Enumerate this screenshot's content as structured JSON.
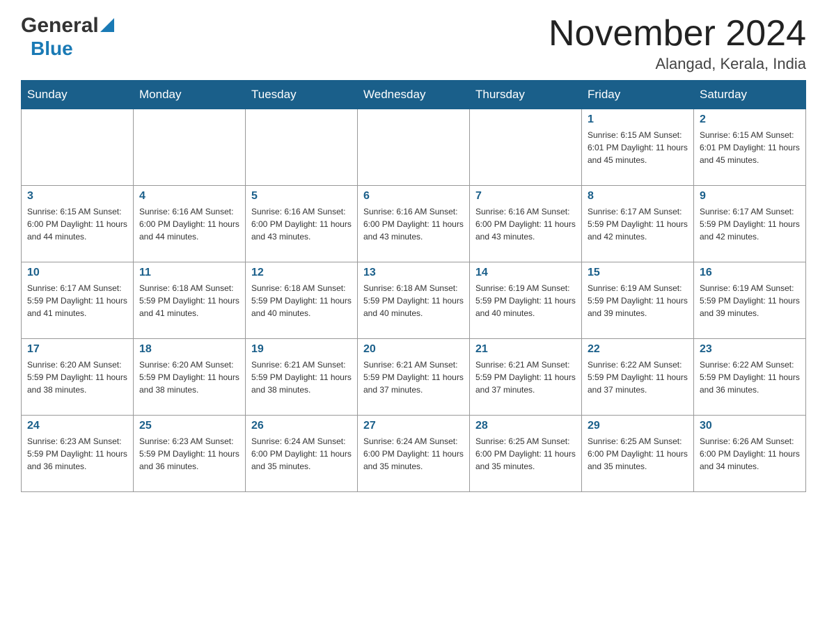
{
  "header": {
    "logo_general": "General",
    "logo_blue": "Blue",
    "month_title": "November 2024",
    "location": "Alangad, Kerala, India"
  },
  "calendar": {
    "days_of_week": [
      "Sunday",
      "Monday",
      "Tuesday",
      "Wednesday",
      "Thursday",
      "Friday",
      "Saturday"
    ],
    "weeks": [
      [
        {
          "day": "",
          "info": ""
        },
        {
          "day": "",
          "info": ""
        },
        {
          "day": "",
          "info": ""
        },
        {
          "day": "",
          "info": ""
        },
        {
          "day": "",
          "info": ""
        },
        {
          "day": "1",
          "info": "Sunrise: 6:15 AM\nSunset: 6:01 PM\nDaylight: 11 hours\nand 45 minutes."
        },
        {
          "day": "2",
          "info": "Sunrise: 6:15 AM\nSunset: 6:01 PM\nDaylight: 11 hours\nand 45 minutes."
        }
      ],
      [
        {
          "day": "3",
          "info": "Sunrise: 6:15 AM\nSunset: 6:00 PM\nDaylight: 11 hours\nand 44 minutes."
        },
        {
          "day": "4",
          "info": "Sunrise: 6:16 AM\nSunset: 6:00 PM\nDaylight: 11 hours\nand 44 minutes."
        },
        {
          "day": "5",
          "info": "Sunrise: 6:16 AM\nSunset: 6:00 PM\nDaylight: 11 hours\nand 43 minutes."
        },
        {
          "day": "6",
          "info": "Sunrise: 6:16 AM\nSunset: 6:00 PM\nDaylight: 11 hours\nand 43 minutes."
        },
        {
          "day": "7",
          "info": "Sunrise: 6:16 AM\nSunset: 6:00 PM\nDaylight: 11 hours\nand 43 minutes."
        },
        {
          "day": "8",
          "info": "Sunrise: 6:17 AM\nSunset: 5:59 PM\nDaylight: 11 hours\nand 42 minutes."
        },
        {
          "day": "9",
          "info": "Sunrise: 6:17 AM\nSunset: 5:59 PM\nDaylight: 11 hours\nand 42 minutes."
        }
      ],
      [
        {
          "day": "10",
          "info": "Sunrise: 6:17 AM\nSunset: 5:59 PM\nDaylight: 11 hours\nand 41 minutes."
        },
        {
          "day": "11",
          "info": "Sunrise: 6:18 AM\nSunset: 5:59 PM\nDaylight: 11 hours\nand 41 minutes."
        },
        {
          "day": "12",
          "info": "Sunrise: 6:18 AM\nSunset: 5:59 PM\nDaylight: 11 hours\nand 40 minutes."
        },
        {
          "day": "13",
          "info": "Sunrise: 6:18 AM\nSunset: 5:59 PM\nDaylight: 11 hours\nand 40 minutes."
        },
        {
          "day": "14",
          "info": "Sunrise: 6:19 AM\nSunset: 5:59 PM\nDaylight: 11 hours\nand 40 minutes."
        },
        {
          "day": "15",
          "info": "Sunrise: 6:19 AM\nSunset: 5:59 PM\nDaylight: 11 hours\nand 39 minutes."
        },
        {
          "day": "16",
          "info": "Sunrise: 6:19 AM\nSunset: 5:59 PM\nDaylight: 11 hours\nand 39 minutes."
        }
      ],
      [
        {
          "day": "17",
          "info": "Sunrise: 6:20 AM\nSunset: 5:59 PM\nDaylight: 11 hours\nand 38 minutes."
        },
        {
          "day": "18",
          "info": "Sunrise: 6:20 AM\nSunset: 5:59 PM\nDaylight: 11 hours\nand 38 minutes."
        },
        {
          "day": "19",
          "info": "Sunrise: 6:21 AM\nSunset: 5:59 PM\nDaylight: 11 hours\nand 38 minutes."
        },
        {
          "day": "20",
          "info": "Sunrise: 6:21 AM\nSunset: 5:59 PM\nDaylight: 11 hours\nand 37 minutes."
        },
        {
          "day": "21",
          "info": "Sunrise: 6:21 AM\nSunset: 5:59 PM\nDaylight: 11 hours\nand 37 minutes."
        },
        {
          "day": "22",
          "info": "Sunrise: 6:22 AM\nSunset: 5:59 PM\nDaylight: 11 hours\nand 37 minutes."
        },
        {
          "day": "23",
          "info": "Sunrise: 6:22 AM\nSunset: 5:59 PM\nDaylight: 11 hours\nand 36 minutes."
        }
      ],
      [
        {
          "day": "24",
          "info": "Sunrise: 6:23 AM\nSunset: 5:59 PM\nDaylight: 11 hours\nand 36 minutes."
        },
        {
          "day": "25",
          "info": "Sunrise: 6:23 AM\nSunset: 5:59 PM\nDaylight: 11 hours\nand 36 minutes."
        },
        {
          "day": "26",
          "info": "Sunrise: 6:24 AM\nSunset: 6:00 PM\nDaylight: 11 hours\nand 35 minutes."
        },
        {
          "day": "27",
          "info": "Sunrise: 6:24 AM\nSunset: 6:00 PM\nDaylight: 11 hours\nand 35 minutes."
        },
        {
          "day": "28",
          "info": "Sunrise: 6:25 AM\nSunset: 6:00 PM\nDaylight: 11 hours\nand 35 minutes."
        },
        {
          "day": "29",
          "info": "Sunrise: 6:25 AM\nSunset: 6:00 PM\nDaylight: 11 hours\nand 35 minutes."
        },
        {
          "day": "30",
          "info": "Sunrise: 6:26 AM\nSunset: 6:00 PM\nDaylight: 11 hours\nand 34 minutes."
        }
      ]
    ]
  }
}
